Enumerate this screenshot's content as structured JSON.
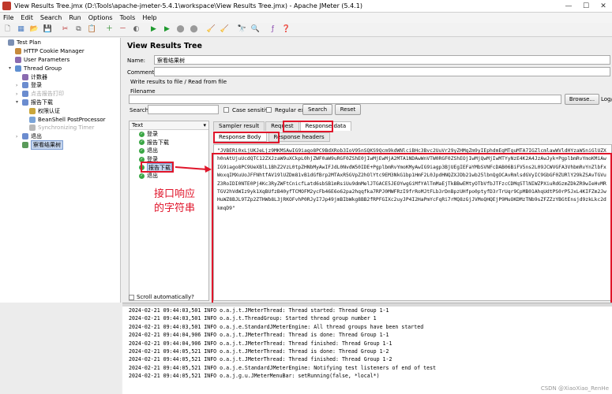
{
  "window": {
    "title": "View Results Tree.jmx (D:\\Tools\\apache-jmeter-5.4.1\\workspace\\View Results Tree.jmx) - Apache JMeter (5.4.1)"
  },
  "menu": [
    "File",
    "Edit",
    "Search",
    "Run",
    "Options",
    "Tools",
    "Help"
  ],
  "tree": [
    {
      "label": "Test Plan",
      "indent": 0,
      "icon": "test-plan-icon",
      "toggle": ""
    },
    {
      "label": "HTTP Cookie Manager",
      "indent": 1,
      "icon": "cookie-manager-icon",
      "toggle": ""
    },
    {
      "label": "User Parameters",
      "indent": 1,
      "icon": "user-parameters-icon",
      "toggle": ""
    },
    {
      "label": "Thread Group",
      "indent": 1,
      "icon": "thread-group-icon",
      "toggle": "▾"
    },
    {
      "label": "计数器",
      "indent": 2,
      "icon": "counter-icon",
      "toggle": ""
    },
    {
      "label": "登录",
      "indent": 2,
      "icon": "sampler-icon",
      "toggle": "›"
    },
    {
      "label": "点击报告打印",
      "indent": 2,
      "icon": "sampler-icon",
      "toggle": "›",
      "disabled": true
    },
    {
      "label": "报告下载",
      "indent": 2,
      "icon": "sampler-icon",
      "toggle": "▾"
    },
    {
      "label": "权限认证",
      "indent": 3,
      "icon": "header-manager-icon",
      "toggle": ""
    },
    {
      "label": "BeanShell PostProcessor",
      "indent": 3,
      "icon": "postprocessor-icon",
      "toggle": ""
    },
    {
      "label": "Synchronizing Timer",
      "indent": 3,
      "icon": "timer-icon",
      "toggle": "",
      "disabled": true
    },
    {
      "label": "退出",
      "indent": 2,
      "icon": "sampler-icon",
      "toggle": "›"
    },
    {
      "label": "察看结果树",
      "indent": 2,
      "icon": "listener-icon",
      "toggle": "",
      "selected": true
    }
  ],
  "panel": {
    "title": "View Results Tree",
    "name_label": "Name:",
    "name_value": "察看结果树",
    "comments_label": "Comments:",
    "write_label": "Write results to file / Read from file",
    "filename_label": "Filename",
    "browse_label": "Browse...",
    "logdisplay_label": "Log/Displ",
    "search_label": "Search:",
    "case_sensitive_label": "Case sensitive",
    "regular_exp_label": "Regular exp.",
    "search_button": "Search",
    "reset_button": "Reset"
  },
  "results": {
    "header": "Text",
    "items": [
      "登录",
      "报告下载",
      "退出",
      "登录",
      "报告下载",
      "退出"
    ],
    "selected_index": 4,
    "scroll_auto_label": "Scroll automatically?"
  },
  "tabs": [
    "Sampler result",
    "Request",
    "Response data"
  ],
  "active_tab": 2,
  "subtabs": [
    "Response Body",
    "Response headers"
  ],
  "active_subtab": 0,
  "response_body": "\"JVBERi0xLjUKJeLjz9MKMSAwIG9iago8PC9BdXRob3IoV95nSQKS9Qcm9kdWNlciBHc3Bvc2UuVr29yZHMgZm9yIEphdmEgMTguMTA7IGZlcmlawWVldHYzaWSniGlUZXh0nAtUjuUcdQTC12ZXJzaW9uXCkpL0hjZWF0aW9uRGF0ZShE0jIwMjEwMjA2MTA1NDAwWnVTW0RGF0ZShEOjIwMjQwMjIwMTYyNzE4K2A4JzAwJyk+PgplbmRvYmoKMiAwIG9iago8PC9UeXBlL1BhZ2VzL0tpZHNbMyAwIFJdL0NvdW50IDE+PgplbmRvYmoKMyAwIG9iagp3BjUEgIEFaYMbSVNFcDAB06BiFV5ns2L09JCWVGFA3VhbmRvYnZlbFxWoxqIMXuUoJFFNhtfAV19lUZDm81vB1dGfBrp2MTAxR5GVpZ2hOlYtc9EM3NkG1bp1HmF2L0JpdHNQZXJDb21wb25lbnQgOCAvRmlsdGVyIC9GbGF0ZURlY29kZSAvTGVuZ3RoIDI0NTE0Pj4Kc3RyZWFtCnicfLatd6sbSB1mRsiUu9dmMelJTGACE5JEOYwgGiMfYAlTmMaEjTkBBwEMtyOTbVfbJTFzcCDMqSTlNIWZPXiuRdGzmZDkZR9wIeHvMRTGV2hVdWIz9yk1XqBUfzB40yfTCMOFM2ycFb46E6o62pa2hqqfka7RPJ0MWFRzI9frRoMJtFLb3rDnBpzUHfpo0ptyfD3rTrUqr9CpMB01AhqUdtPS0rP5JxL4KIFZm2JwHuWZ8BJL9TZp2ZTHWb8L3jRKOFvhP0RJyI7Jp49jmBIbWkg8BB2fRPFGIXc2uyJP4I2HaPmYcFqRi7rMQ8zGjJVMoQHQEjP9MuOKDMzTNb9sZFZZzYBGtEnsjd9zkLkc2dkmqD9\"",
  "log_lines": [
    "2024-02-21 09:44:03,501 INFO o.a.j.t.JMeterThread: Thread started: Thread Group 1-1",
    "2024-02-21 09:44:03,501 INFO o.a.j.t.ThreadGroup: Started thread group number 1",
    "2024-02-21 09:44:03,501 INFO o.a.j.e.StandardJMeterEngine: All thread groups have been started",
    "2024-02-21 09:44:04,906 INFO o.a.j.t.JMeterThread: Thread is done: Thread Group 1-1",
    "2024-02-21 09:44:04,906 INFO o.a.j.t.JMeterThread: Thread finished: Thread Group 1-1",
    "2024-02-21 09:44:05,521 INFO o.a.j.t.JMeterThread: Thread is done: Thread Group 1-2",
    "2024-02-21 09:44:05,521 INFO o.a.j.t.JMeterThread: Thread finished: Thread Group 1-2",
    "2024-02-21 09:44:05,521 INFO o.a.j.e.StandardJMeterEngine: Notifying test listeners of end of test",
    "2024-02-21 09:44:05,521 INFO o.a.j.g.u.JMeterMenuBar: setRunning(false, *local*)"
  ],
  "annotation": {
    "line1": "接口响应",
    "line2": "的字符串",
    "color": "#e0162b"
  },
  "watermark": "CSDN @XiaoXiao_RenHe"
}
